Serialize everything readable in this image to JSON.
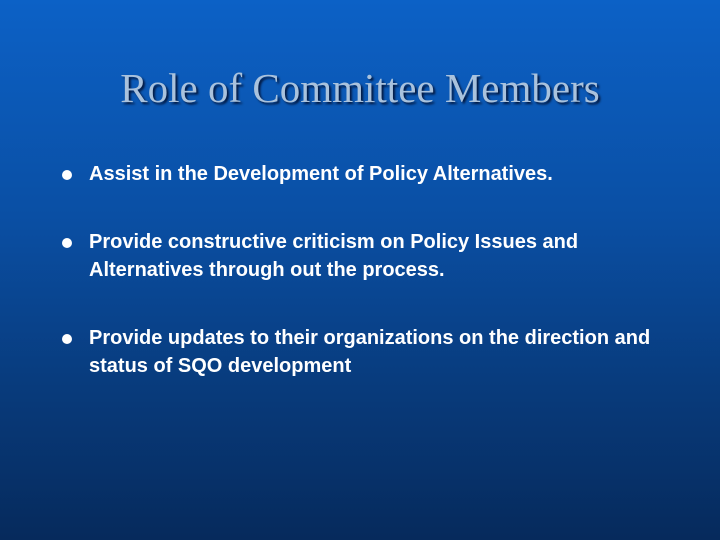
{
  "slide": {
    "title": "Role of Committee Members",
    "bullets": [
      "Assist in the Development of Policy Alternatives.",
      "Provide constructive criticism on Policy Issues and Alternatives through out the process.",
      "Provide updates to their organizations on the direction and status of SQO development"
    ]
  }
}
